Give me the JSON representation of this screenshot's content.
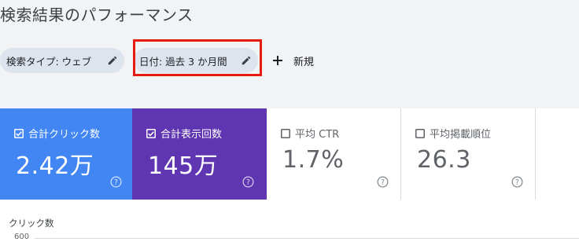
{
  "page": {
    "title": "検索結果のパフォーマンス"
  },
  "filters": {
    "search_type": {
      "label": "検索タイプ: ウェブ",
      "icon": "pencil-icon"
    },
    "date": {
      "label": "日付: 過去 3 か月間",
      "icon": "pencil-icon",
      "highlight_color": "#e8190f"
    },
    "new_button": {
      "label": "新規",
      "icon": "plus-icon"
    }
  },
  "metrics": [
    {
      "label": "合計クリック数",
      "value": "2.42万",
      "checked": true,
      "color": "#4286f4"
    },
    {
      "label": "合計表示回数",
      "value": "145万",
      "checked": true,
      "color": "#5f35b1"
    },
    {
      "label": "平均 CTR",
      "value": "1.7%",
      "checked": false,
      "color": "#ffffff"
    },
    {
      "label": "平均掲載順位",
      "value": "26.3",
      "checked": false,
      "color": "#ffffff"
    }
  ],
  "chart": {
    "axis_title": "クリック数",
    "top_tick": "600"
  }
}
